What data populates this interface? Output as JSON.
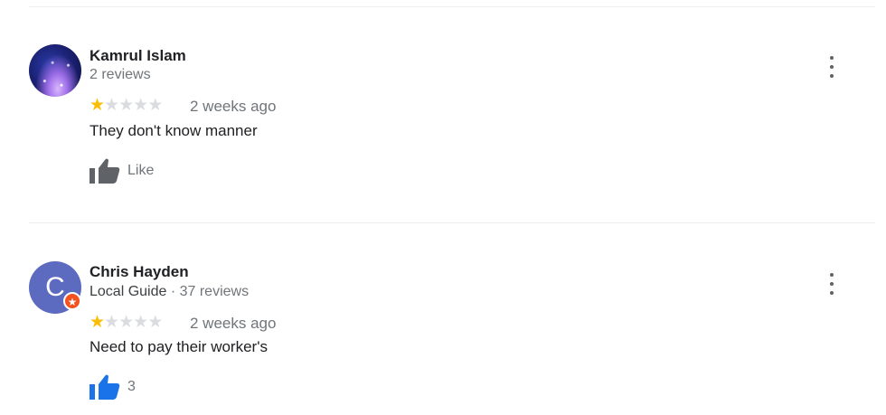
{
  "reviews": [
    {
      "name": "Kamrul Islam",
      "meta": "2 reviews",
      "local_guide": "",
      "rating": 1,
      "rating_max": 5,
      "date": "2 weeks ago",
      "text": "They don't know manner",
      "like_label": "Like",
      "liked": false,
      "avatar_icon": "galaxy-avatar"
    },
    {
      "name": "Chris Hayden",
      "local_guide": "Local Guide",
      "meta": "37 reviews",
      "rating": 1,
      "rating_max": 5,
      "date": "2 weeks ago",
      "text": "Need to pay their worker's",
      "like_label": "3",
      "liked": true,
      "avatar_letter": "C",
      "badge_icon": "local-guide-star-icon"
    }
  ],
  "colors": {
    "star_filled": "#fbbc04",
    "star_empty": "#dadce0",
    "liked_blue": "#1a73e8",
    "unliked_gray": "#5f6368",
    "avatar_indigo": "#5c6bc0",
    "badge_orange": "#f4511e"
  }
}
